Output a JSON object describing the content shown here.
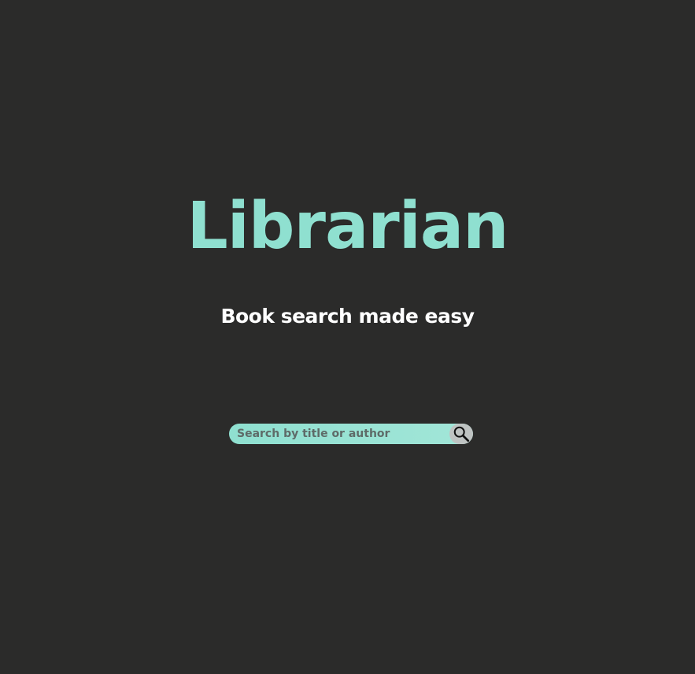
{
  "app": {
    "title": "Librarian",
    "tagline": "Book search made easy"
  },
  "search": {
    "placeholder": "Search by title or author",
    "value": "",
    "button_icon": "search-icon"
  },
  "colors": {
    "background": "#2b2b2a",
    "accent": "#8fe0d0",
    "tagline": "#ffffff",
    "search_button": "#bfc3c2"
  }
}
